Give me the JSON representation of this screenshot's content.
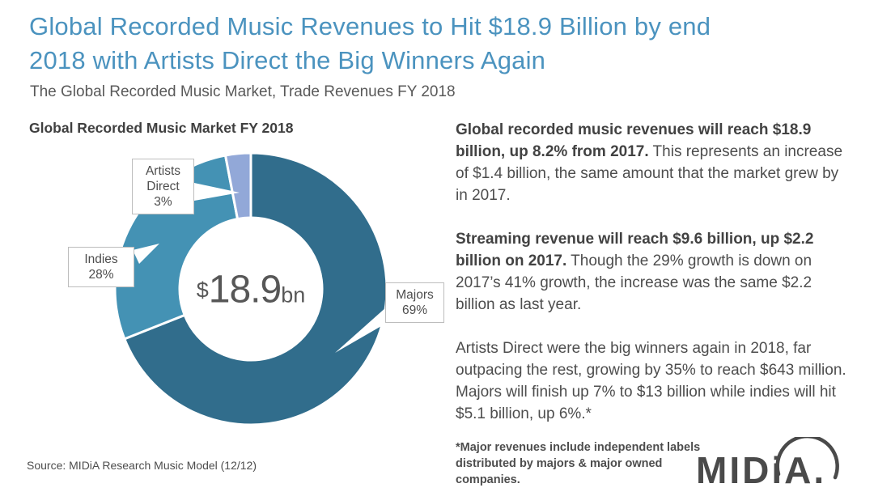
{
  "header": {
    "title_lines": [
      "Global Recorded Music Revenues to Hit $18.9 Billion by end",
      "2018 with Artists Direct the Big Winners Again"
    ],
    "subtitle": "The Global Recorded Music Market, Trade Revenues FY 2018"
  },
  "chart_data": {
    "type": "pie",
    "donut": true,
    "title": "Global Recorded Music Market FY 2018",
    "start_at": "top",
    "direction": "clockwise",
    "center_label": {
      "prefix": "$",
      "value": "18.9",
      "suffix": "bn"
    },
    "slices": [
      {
        "label": "Majors",
        "pct": 69,
        "pct_label": "69%",
        "color": "#316D8C"
      },
      {
        "label": "Indies",
        "pct": 28,
        "pct_label": "28%",
        "color": "#4492B4"
      },
      {
        "label": "Artists Direct",
        "pct": 3,
        "pct_label": "3%",
        "color": "#92A8D8"
      }
    ],
    "colors": {
      "gap": "#ffffff",
      "label_border": "#bdbdbd",
      "center_text": "#575757"
    }
  },
  "main": {
    "paragraphs": [
      {
        "bold": "Global recorded music revenues will reach $18.9 billion, up 8.2% from 2017.",
        "rest": " This represents an increase of $1.4 billion, the same amount that the market grew by in 2017."
      },
      {
        "bold": "Streaming revenue will reach $9.6 billion, up $2.2 billion on 2017.",
        "rest": " Though the 29% growth is down on 2017’s 41% growth, the increase was the same $2.2 billion as last year."
      },
      {
        "bold": "",
        "rest": "Artists Direct were the big winners again in 2018, far outpacing the rest, growing by 35% to reach $643 million. Majors will finish up 7% to $13 billion while indies will hit $5.1 billion, up 6%.*"
      }
    ],
    "footnote": "*Major revenues include independent labels distributed by majors & major owned companies."
  },
  "footer": {
    "source": "Source: MIDiA Research Music Model (12/12)",
    "logo_text": "MIDiA."
  }
}
